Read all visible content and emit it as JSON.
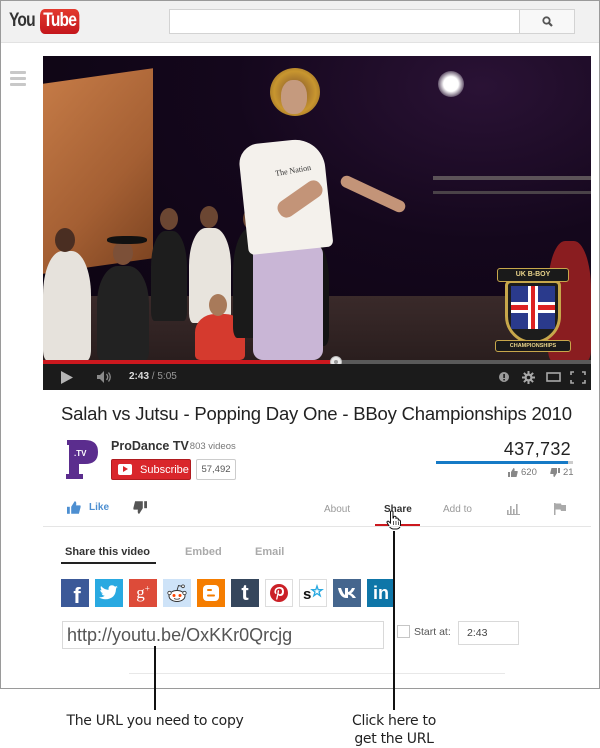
{
  "masthead": {
    "logo_you": "You",
    "logo_tube": "Tube",
    "search_placeholder": "",
    "search_icon": "magnifier-icon"
  },
  "player": {
    "current_time": "2:43",
    "separator": " / ",
    "duration": "5:05",
    "progress_fraction": 0.535,
    "watermark_top": "UK B-BOY",
    "watermark_bottom": "CHAMPIONSHIPS",
    "shirt_text": "The Nation",
    "icons": [
      "play-icon",
      "volume-icon",
      "annotations-icon",
      "settings-gear-icon",
      "theater-mode-icon",
      "fullscreen-icon"
    ]
  },
  "video": {
    "title": "Salah vs Jutsu - Popping Day One - BBoy Championships 2010",
    "views": "437,732",
    "likes": "620",
    "dislikes": "21",
    "like_ratio": 0.967
  },
  "channel": {
    "name": "ProDance TV",
    "video_count": "· 803 videos",
    "logo_letter": "P",
    "logo_sub": ".TV",
    "subscribe_label": "Subscribe",
    "subscriber_count": "57,492"
  },
  "actions": {
    "like_label": "Like",
    "tabs": [
      {
        "label": "About",
        "active": false
      },
      {
        "label": "Share",
        "active": true
      },
      {
        "label": "Add to",
        "active": false
      }
    ]
  },
  "share": {
    "subtabs": [
      {
        "label": "Share this video",
        "active": true
      },
      {
        "label": "Embed",
        "active": false
      },
      {
        "label": "Email",
        "active": false
      }
    ],
    "services": [
      {
        "name": "Facebook",
        "glyph": "f",
        "color": "#3b5998"
      },
      {
        "name": "Twitter",
        "glyph": "t",
        "color": "#29a9e1"
      },
      {
        "name": "Google+",
        "glyph": "g+",
        "color": "#dd4b39"
      },
      {
        "name": "Reddit",
        "glyph": "reddit",
        "color": "#cee3f8"
      },
      {
        "name": "Blogger",
        "glyph": "B",
        "color": "#f57d00"
      },
      {
        "name": "Tumblr",
        "glyph": "t",
        "color": "#35465c"
      },
      {
        "name": "Pinterest",
        "glyph": "P",
        "color": "#ffffff"
      },
      {
        "name": "StumbleUpon",
        "glyph": "s",
        "color": "#ffffff"
      },
      {
        "name": "VK",
        "glyph": "vk",
        "color": "#45668e"
      },
      {
        "name": "LinkedIn",
        "glyph": "in",
        "color": "#0e76a8"
      }
    ],
    "url": "http://youtu.be/OxKKr0Qrcjg",
    "start_at_label": "Start at:",
    "start_at_value": "2:43",
    "start_at_checked": false
  },
  "callouts": {
    "url_note": "The URL you need to copy",
    "share_note_line1": "Click here to",
    "share_note_line2": "get the URL"
  },
  "colors": {
    "brand_red": "#cc181e",
    "link_blue": "#167ac6",
    "channel_purple": "#5b2d8e"
  }
}
